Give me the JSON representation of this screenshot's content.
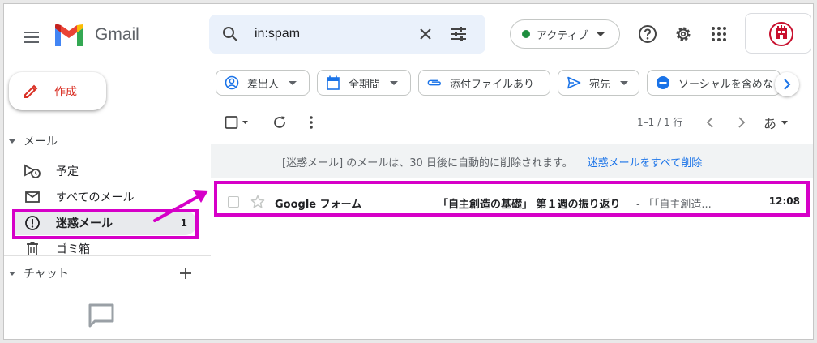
{
  "header": {
    "brand": "Gmail",
    "search_value": "in:spam",
    "status_label": "アクティブ"
  },
  "sidebar": {
    "compose_label": "作成",
    "mail_section": "メール",
    "items": [
      {
        "label": "予定",
        "icon": "scheduled-icon"
      },
      {
        "label": "すべてのメール",
        "icon": "mail-icon"
      },
      {
        "label": "迷惑メール",
        "icon": "spam-icon",
        "count": "1",
        "active": true
      },
      {
        "label": "ゴミ箱",
        "icon": "trash-icon"
      }
    ],
    "chat_section": "チャット"
  },
  "filters": [
    {
      "label": "差出人",
      "icon": "person-icon"
    },
    {
      "label": "全期間",
      "icon": "calendar-icon"
    },
    {
      "label": "添付ファイルあり",
      "icon": "attachment-icon"
    },
    {
      "label": "宛先",
      "icon": "send-icon"
    },
    {
      "label": "ソーシャルを含めな",
      "icon": "minus-circle-icon"
    }
  ],
  "toolbar": {
    "pager": "1–1 / 1 行",
    "input_tool": "あ"
  },
  "notice": {
    "text": "[迷惑メール] のメールは、30 日後に自動的に削除されます。",
    "link": "迷惑メールをすべて削除"
  },
  "emails": [
    {
      "sender": "Google フォーム",
      "subject": "「自主創造の基礎」 第１週の振り返り",
      "snippet": "- 「「自主創造...",
      "time": "12:08"
    }
  ],
  "colors": {
    "highlight": "#d600c8",
    "accent": "#d93025",
    "link": "#1a73e8",
    "active_status": "#1e8e3e"
  }
}
